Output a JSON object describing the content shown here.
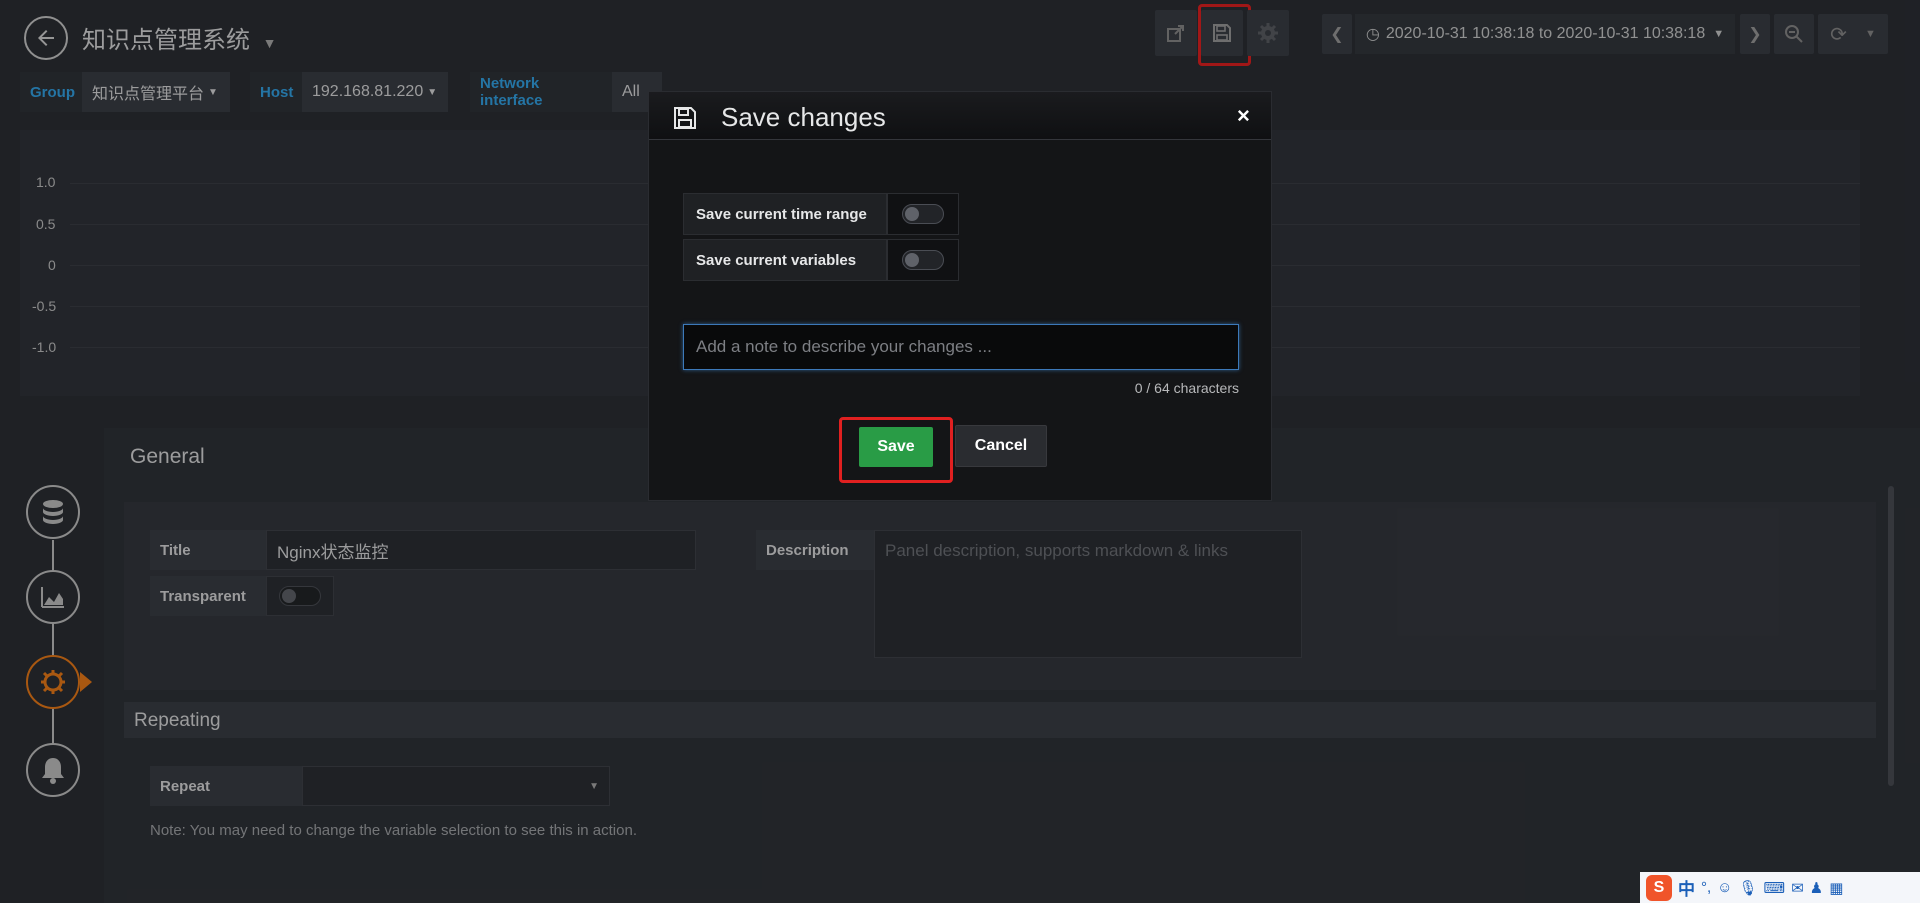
{
  "header": {
    "dashboard_title": "知识点管理系统",
    "time_range": "2020-10-31 10:38:18 to 2020-10-31 10:38:18"
  },
  "variables": [
    {
      "label": "Group",
      "value": "知识点管理平台"
    },
    {
      "label": "Host",
      "value": "192.168.81.220"
    },
    {
      "label": "Network interface",
      "value": "All"
    }
  ],
  "graph": {
    "y_ticks": [
      "1.0",
      "0.5",
      "0",
      "-0.5",
      "-1.0"
    ]
  },
  "editor": {
    "general_title": "General",
    "title_label": "Title",
    "title_value": "Nginx状态监控",
    "description_label": "Description",
    "description_placeholder": "Panel description, supports markdown & links",
    "transparent_label": "Transparent",
    "repeating_title": "Repeating",
    "repeat_label": "Repeat",
    "repeat_note": "Note: You may need to change the variable selection to see this in action."
  },
  "modal": {
    "title": "Save changes",
    "option_time_range": "Save current time range",
    "option_variables": "Save current variables",
    "note_placeholder": "Add a note to describe your changes ...",
    "char_count": "0 / 64 characters",
    "save_label": "Save",
    "cancel_label": "Cancel",
    "close_glyph": "×"
  },
  "taskbar": {
    "ime_logo": "S",
    "ime_mode": "中"
  },
  "colors": {
    "accent_blue": "#33a2e5",
    "save_green": "#299c46",
    "highlight_red": "#e02020"
  }
}
